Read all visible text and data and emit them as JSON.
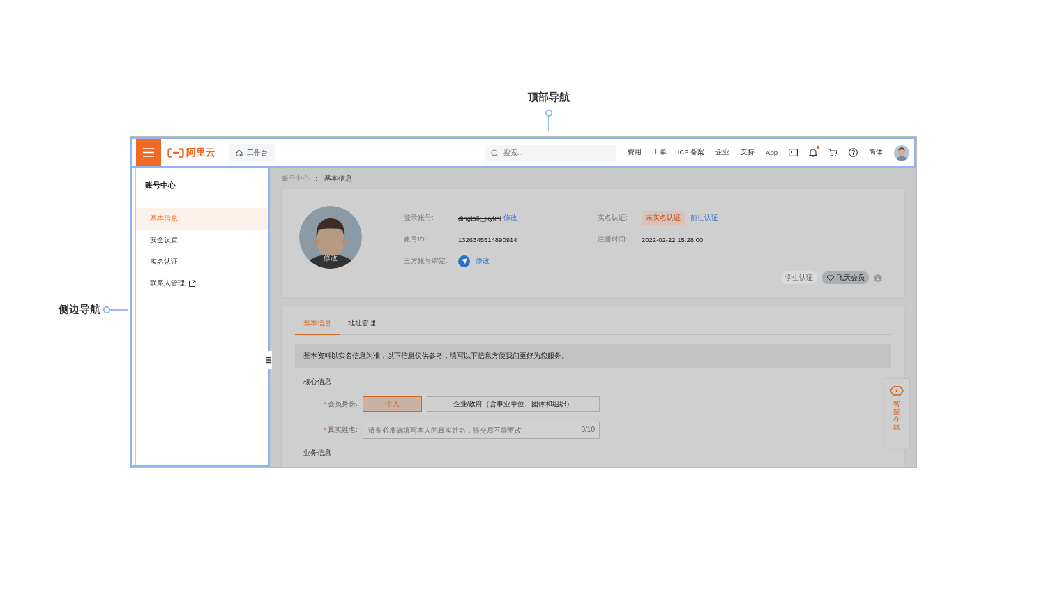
{
  "top_annotation": {
    "label": "顶部导航"
  },
  "side_annotation": {
    "label": "侧边导航"
  },
  "top_bar": {
    "logo": "阿里云",
    "workbench": "工作台",
    "search": {
      "placeholder": "搜索..."
    },
    "nav_links": [
      "费用",
      "工单",
      "ICP 备案",
      "企业",
      "支持",
      "App"
    ],
    "unread_notifications": true,
    "language": "简体"
  },
  "sidebar": {
    "title": "账号中心",
    "items": [
      {
        "label": "基本信息",
        "selected": true,
        "external": false
      },
      {
        "label": "安全设置",
        "selected": false,
        "external": false
      },
      {
        "label": "实名认证",
        "selected": false,
        "external": false
      },
      {
        "label": "联系人管理",
        "selected": false,
        "external": true
      }
    ]
  },
  "breadcrumb": [
    "账号中心",
    "基本信息"
  ],
  "profile": {
    "avatar_action": "修改",
    "left_fields": [
      {
        "kind": "text",
        "label": "登录账号:",
        "value": "dingtalk_jxykhl",
        "redacted": true,
        "link": "修改"
      },
      {
        "kind": "text",
        "label": "账号ID:",
        "value": "1326345514890914",
        "redacted": false
      },
      {
        "kind": "binding",
        "label": "三方账号绑定:",
        "link": "修改"
      }
    ],
    "right_fields": [
      {
        "kind": "status",
        "label": "实名认证:",
        "value": "未实名认证",
        "link": "前往认证"
      },
      {
        "kind": "text",
        "label": "注册时间:",
        "value": "2022-02-22 15:28:00"
      }
    ],
    "badges": [
      {
        "kind": "plain",
        "label": "学生认证"
      },
      {
        "kind": "member",
        "label": "飞天会员"
      }
    ]
  },
  "tabs": [
    {
      "label": "基本信息",
      "selected": true
    },
    {
      "label": "地址管理",
      "selected": false
    }
  ],
  "notice": "基本资料以实名信息为准，以下信息仅供参考，填写以下信息方便我们更好为您服务。",
  "core_section": {
    "title": "核心信息",
    "rows": [
      {
        "kind": "choice",
        "marker": "*",
        "label": "会员身份:",
        "options": [
          {
            "label": "个人",
            "selected": true
          },
          {
            "label": "企业/政府（含事业单位、团体和组织）",
            "selected": false
          }
        ]
      },
      {
        "kind": "input",
        "marker": "*",
        "label": "真实姓名:",
        "placeholder": "请务必准确填写本人的真实姓名，提交后不能更改",
        "counter": "0/10"
      }
    ]
  },
  "business_section": {
    "title": "业务信息"
  },
  "assistant": {
    "label": "智能在线"
  }
}
